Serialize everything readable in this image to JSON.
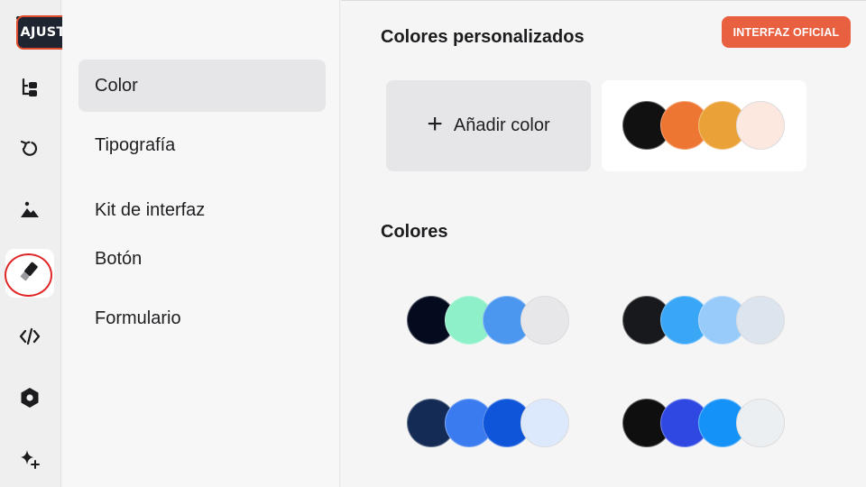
{
  "title_badge": "AJUSTES GLOBALES DE DISEÑO",
  "official_button": "INTERFAZ OFICIAL",
  "rail": {
    "icons": [
      "structure-icon",
      "history-icon",
      "image-icon",
      "brush-icon",
      "code-icon",
      "hexagon-icon",
      "sparkles-icon"
    ],
    "active": "brush-icon"
  },
  "menu": {
    "color": "Color",
    "typography": "Tipografía",
    "ui_kit": "Kit de interfaz",
    "button": "Botón",
    "form": "Formulario"
  },
  "custom_colors": {
    "title": "Colores personalizados",
    "add_label": "Añadir color",
    "add_icon": "+",
    "palette": [
      "#111111",
      "#ee7633",
      "#eaa238",
      "#fde8df"
    ]
  },
  "colors": {
    "title": "Colores",
    "palettes": [
      [
        "#050b1f",
        "#8ef0c8",
        "#4b97f0",
        "#e7e7e9"
      ],
      [
        "#17191d",
        "#3aa6f6",
        "#98cbf9",
        "#dce4ee"
      ],
      [
        "#142c55",
        "#3a7bef",
        "#0f55d9",
        "#dce8fc"
      ],
      [
        "#0f0f10",
        "#2f48e2",
        "#1592f7",
        "#eceff2"
      ]
    ]
  },
  "accent_color": "#e8603f"
}
